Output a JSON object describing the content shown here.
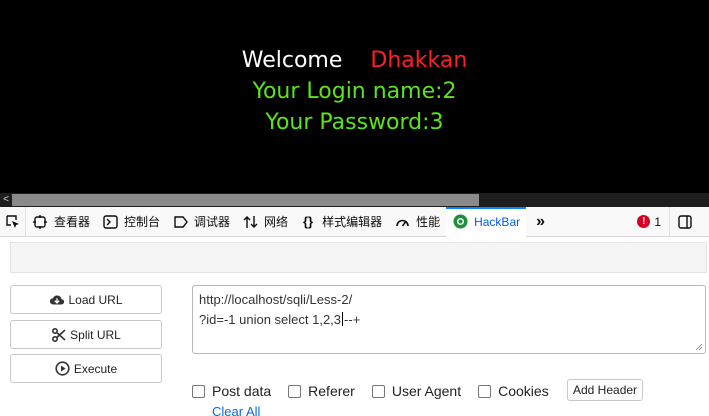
{
  "page": {
    "welcome": "Welcome",
    "user": "Dhakkan",
    "login_line": "Your Login name:2",
    "password_line": "Your Password:3"
  },
  "scrollbar": {
    "left_arrow": "<"
  },
  "devtools": {
    "tabs": [
      {
        "label": "查看器",
        "icon": "inspector-icon"
      },
      {
        "label": "控制台",
        "icon": "console-icon"
      },
      {
        "label": "调试器",
        "icon": "debugger-icon"
      },
      {
        "label": "网络",
        "icon": "network-icon"
      },
      {
        "label": "样式编辑器",
        "icon": "style-editor-icon"
      },
      {
        "label": "性能",
        "icon": "performance-icon"
      },
      {
        "label": "HackBar",
        "icon": "hackbar-icon"
      }
    ],
    "more": "»",
    "error_count": "1",
    "error_icon": "!"
  },
  "hackbar": {
    "load_url": "Load URL",
    "split_url": "Split URL",
    "execute": "Execute",
    "url_line1": "http://localhost/sqli/Less-2/",
    "url_line2_before_caret": "?id=-1 union select 1,2,3",
    "url_line2_after_caret": "--+",
    "options": [
      "Post data",
      "Referer",
      "User Agent",
      "Cookies"
    ],
    "add_header": "Add Header",
    "clear_all": "Clear All"
  },
  "colors": {
    "page_bg": "#000000",
    "welcome": "#ffffff",
    "user": "#ff1f1f",
    "info": "#5be31d",
    "active_tab": "#0060df",
    "error_badge": "#d70022",
    "link": "#0a6ad8"
  }
}
